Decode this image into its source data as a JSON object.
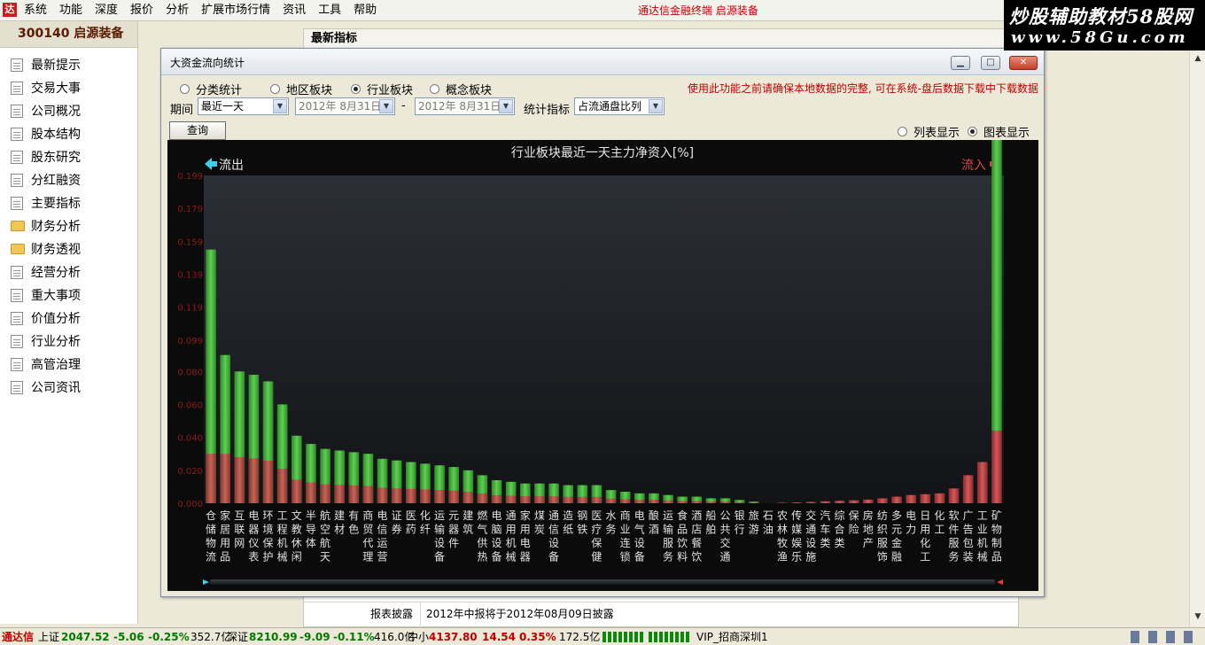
{
  "menubar": {
    "logo": "达",
    "items": [
      "系统",
      "功能",
      "深度",
      "报价",
      "分析",
      "扩展市场行情",
      "资讯",
      "工具",
      "帮助"
    ],
    "center_text": "通达信金融终端   启源装备"
  },
  "brand": {
    "title": "炒股辅助教材58股网",
    "url": "www.58Gu.com"
  },
  "sidebar": {
    "stock_header": "300140  启源装备",
    "items": [
      {
        "label": "最新提示",
        "type": "doc"
      },
      {
        "label": "交易大事",
        "type": "doc"
      },
      {
        "label": "公司概况",
        "type": "doc"
      },
      {
        "label": "股本结构",
        "type": "doc"
      },
      {
        "label": "股东研究",
        "type": "doc"
      },
      {
        "label": "分红融资",
        "type": "doc"
      },
      {
        "label": "主要指标",
        "type": "doc"
      },
      {
        "label": "财务分析",
        "type": "folder"
      },
      {
        "label": "财务透视",
        "type": "folder"
      },
      {
        "label": "经营分析",
        "type": "doc"
      },
      {
        "label": "重大事项",
        "type": "doc"
      },
      {
        "label": "价值分析",
        "type": "doc"
      },
      {
        "label": "行业分析",
        "type": "doc"
      },
      {
        "label": "高管治理",
        "type": "doc"
      },
      {
        "label": "公司资讯",
        "type": "doc"
      }
    ]
  },
  "main": {
    "tab_title": "最新指标",
    "report_label": "报表披露",
    "report_value": "2012年中报将于2012年08月09日披露"
  },
  "dialog": {
    "title": "大资金流向统计",
    "radios": [
      {
        "label": "分类统计",
        "checked": false
      },
      {
        "label": "地区板块",
        "checked": false
      },
      {
        "label": "行业板块",
        "checked": true
      },
      {
        "label": "概念板块",
        "checked": false
      }
    ],
    "warning": "使用此功能之前请确保本地数据的完整, 可在系统-盘后数据下载中下载数据",
    "period_label": "期间",
    "period_value": "最近一天",
    "date_from": "2012年 8月31日",
    "date_sep": "-",
    "date_to": "2012年 8月31日",
    "stat_label": "统计指标",
    "stat_value": "占流通盘比列",
    "query_button": "查询",
    "view_list": "列表显示",
    "view_chart": "图表显示",
    "view_chart_checked": true
  },
  "chart_data": {
    "type": "bar",
    "title": "行业板块最近一天主力净资入[%]",
    "outflow_label": "流出",
    "inflow_label": "流入",
    "y_ticks": [
      "0.000",
      "0.020",
      "0.040",
      "0.060",
      "0.080",
      "0.099",
      "0.119",
      "0.139",
      "0.159",
      "0.179",
      "0.199"
    ],
    "ylim": [
      0,
      0.199
    ],
    "categories": [
      "仓储物流",
      "家居用品",
      "互联网",
      "电器仪表",
      "环境保护",
      "工程机械",
      "文教休闲",
      "半导体",
      "航空航天",
      "建材",
      "有色",
      "商贸代理",
      "电信运营",
      "证券",
      "医药",
      "化纤",
      "运输设备",
      "元器件",
      "建筑",
      "燃气供热",
      "电脑设备",
      "通用机械",
      "家用电器",
      "煤炭",
      "通信设备",
      "造纸",
      "钢铁",
      "医疗保健",
      "水务",
      "商业连锁",
      "电气设备",
      "酿酒",
      "运输服务",
      "食品饮料",
      "酒店餐饮",
      "船舶",
      "公共交通",
      "银行",
      "旅游",
      "石油",
      "农林牧渔",
      "传媒娱乐",
      "交通设施",
      "汽车类",
      "综合类",
      "保险",
      "房地产",
      "纺织服饰",
      "多元金融",
      "电力",
      "日用化工",
      "化工",
      "软件服务",
      "广告包装",
      "工业机械",
      "矿物制品"
    ],
    "series": [
      {
        "name": "流出",
        "color": "#3fae35",
        "values": [
          0.154,
          0.09,
          0.08,
          0.078,
          0.074,
          0.06,
          0.041,
          0.036,
          0.033,
          0.032,
          0.031,
          0.03,
          0.027,
          0.026,
          0.025,
          0.024,
          0.023,
          0.022,
          0.02,
          0.017,
          0.014,
          0.013,
          0.012,
          0.012,
          0.012,
          0.011,
          0.011,
          0.011,
          0.008,
          0.007,
          0.006,
          0.006,
          0.005,
          0.004,
          0.004,
          0.003,
          0.003,
          0.002,
          0.001,
          0,
          0,
          0,
          0,
          0,
          0,
          0,
          0,
          0,
          0,
          0,
          0,
          0,
          0,
          0,
          0,
          0
        ]
      },
      {
        "name": "流入",
        "color": "#b5393a",
        "values": [
          0,
          0,
          0,
          0,
          0,
          0,
          0,
          0,
          0,
          0,
          0,
          0,
          0,
          0,
          0,
          0,
          0,
          0,
          0,
          0,
          0,
          0,
          0,
          0,
          0,
          0,
          0,
          0,
          0,
          0,
          0,
          0,
          0,
          0,
          0,
          0,
          0,
          0,
          0,
          0,
          0.0003,
          0.0005,
          0.0008,
          0.0012,
          0.0015,
          0.0018,
          0.0022,
          0.003,
          0.004,
          0.005,
          0.0055,
          0.006,
          0.009,
          0.017,
          0.025,
          0.044
        ]
      },
      {
        "name": "",
        "color": "#3fae35",
        "values": [
          0,
          0,
          0,
          0,
          0,
          0,
          0,
          0,
          0,
          0,
          0,
          0,
          0,
          0,
          0,
          0,
          0,
          0,
          0,
          0,
          0,
          0,
          0,
          0,
          0,
          0,
          0,
          0,
          0,
          0,
          0,
          0,
          0,
          0,
          0,
          0,
          0,
          0,
          0,
          0,
          0,
          0,
          0,
          0,
          0,
          0,
          0,
          0,
          0,
          0,
          0,
          0,
          0,
          0,
          0,
          0.2
        ]
      }
    ],
    "grid": false,
    "legend": "top"
  },
  "statusbar": {
    "app_name": "通达信",
    "sh_label": "上证",
    "sh_index": "2047.52",
    "sh_change": "-5.06",
    "sh_pct": "-0.25%",
    "sh_amount": "352.7亿",
    "sz_label": "深证",
    "sz_index": "8210.99",
    "sz_change": "-9.09",
    "sz_pct": "-0.11%",
    "sz_amount": "416.0亿",
    "zx_label": "中小",
    "zx_index": "4137.80",
    "zx_change": "14.54",
    "zx_pct": "0.35%",
    "zx_amount": "172.5亿",
    "vip_text": "VIP_招商深圳1",
    "up_color": "#c00000",
    "down_color": "#007a00"
  }
}
